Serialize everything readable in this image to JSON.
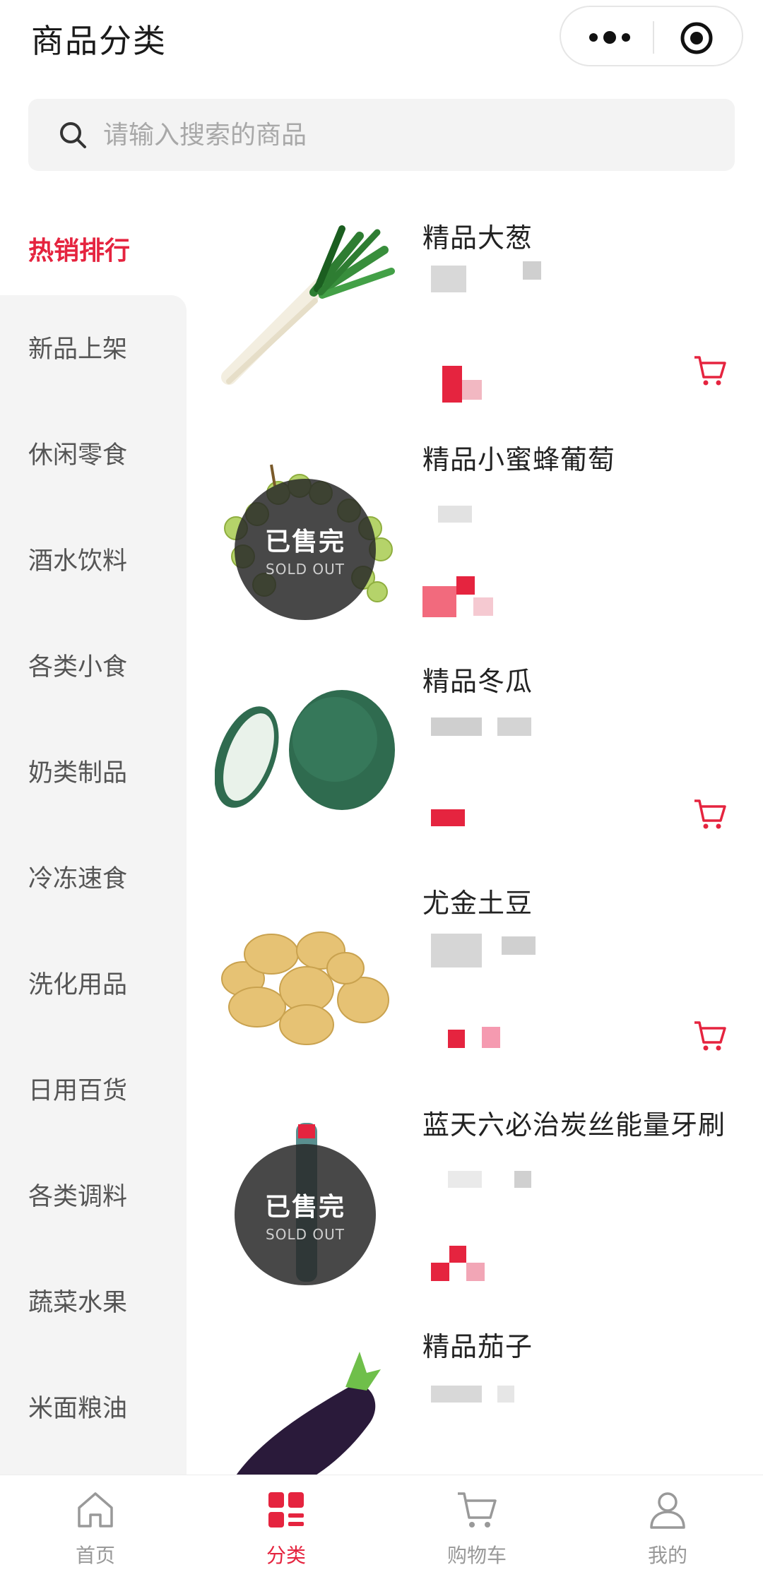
{
  "header": {
    "title": "商品分类"
  },
  "search": {
    "placeholder": "请输入搜索的商品"
  },
  "sidebar": {
    "active_label": "热销排行",
    "items": [
      {
        "label": "新品上架"
      },
      {
        "label": "休闲零食"
      },
      {
        "label": "酒水饮料"
      },
      {
        "label": "各类小食"
      },
      {
        "label": "奶类制品"
      },
      {
        "label": "冷冻速食"
      },
      {
        "label": "洗化用品"
      },
      {
        "label": "日用百货"
      },
      {
        "label": "各类调料"
      },
      {
        "label": "蔬菜水果"
      },
      {
        "label": "米面粮油"
      }
    ]
  },
  "products": [
    {
      "name": "精品大葱",
      "image": "scallion",
      "sold_out": false
    },
    {
      "name": "精品小蜜蜂葡萄",
      "image": "grapes",
      "sold_out": true
    },
    {
      "name": "精品冬瓜",
      "image": "winter-melon",
      "sold_out": false
    },
    {
      "name": "尤金土豆",
      "image": "potatoes",
      "sold_out": false
    },
    {
      "name": "蓝天六必治炭丝能量牙刷",
      "image": "toothbrush",
      "sold_out": true
    },
    {
      "name": "精品茄子",
      "image": "eggplant",
      "sold_out": false
    }
  ],
  "sold_out_badge": {
    "main": "已售完",
    "sub": "SOLD OUT"
  },
  "tabbar": {
    "tabs": [
      {
        "label": "首页",
        "icon": "home-icon"
      },
      {
        "label": "分类",
        "icon": "category-icon",
        "active": true
      },
      {
        "label": "购物车",
        "icon": "cart-icon"
      },
      {
        "label": "我的",
        "icon": "user-icon"
      }
    ]
  },
  "colors": {
    "accent": "#e5243f",
    "sidebar_bg": "#f4f4f4",
    "search_bg": "#f3f3f3"
  }
}
